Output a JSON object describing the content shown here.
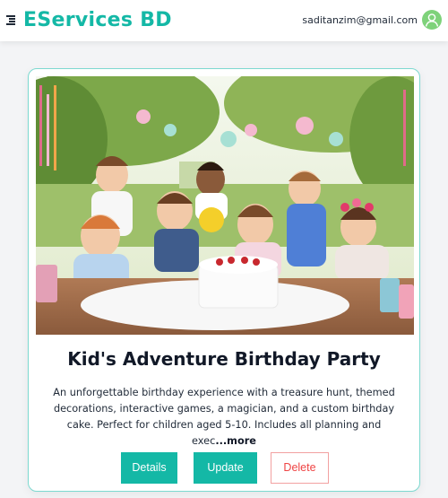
{
  "header": {
    "brand": "EServices BD",
    "user_email": "saditanzim@gmail.com",
    "menu_icon": "hamburger-icon",
    "avatar_icon": "user-avatar-icon"
  },
  "service_card": {
    "image_alt": "Children celebrating at an outdoor birthday party with a cake",
    "title": "Kid's Adventure Birthday Party",
    "description": "An unforgettable birthday experience with a treasure hunt, themed decorations, interactive games, a magician, and a custom birthday cake. Perfect for children aged 5-10. Includes all planning and exec",
    "more_label": "...more",
    "buttons": {
      "details": "Details",
      "update": "Update",
      "delete": "Delete"
    }
  },
  "colors": {
    "brand": "#14b8a6",
    "card_border": "#7dd9d0",
    "delete": "#ef4444",
    "avatar": "#7ed27a"
  }
}
